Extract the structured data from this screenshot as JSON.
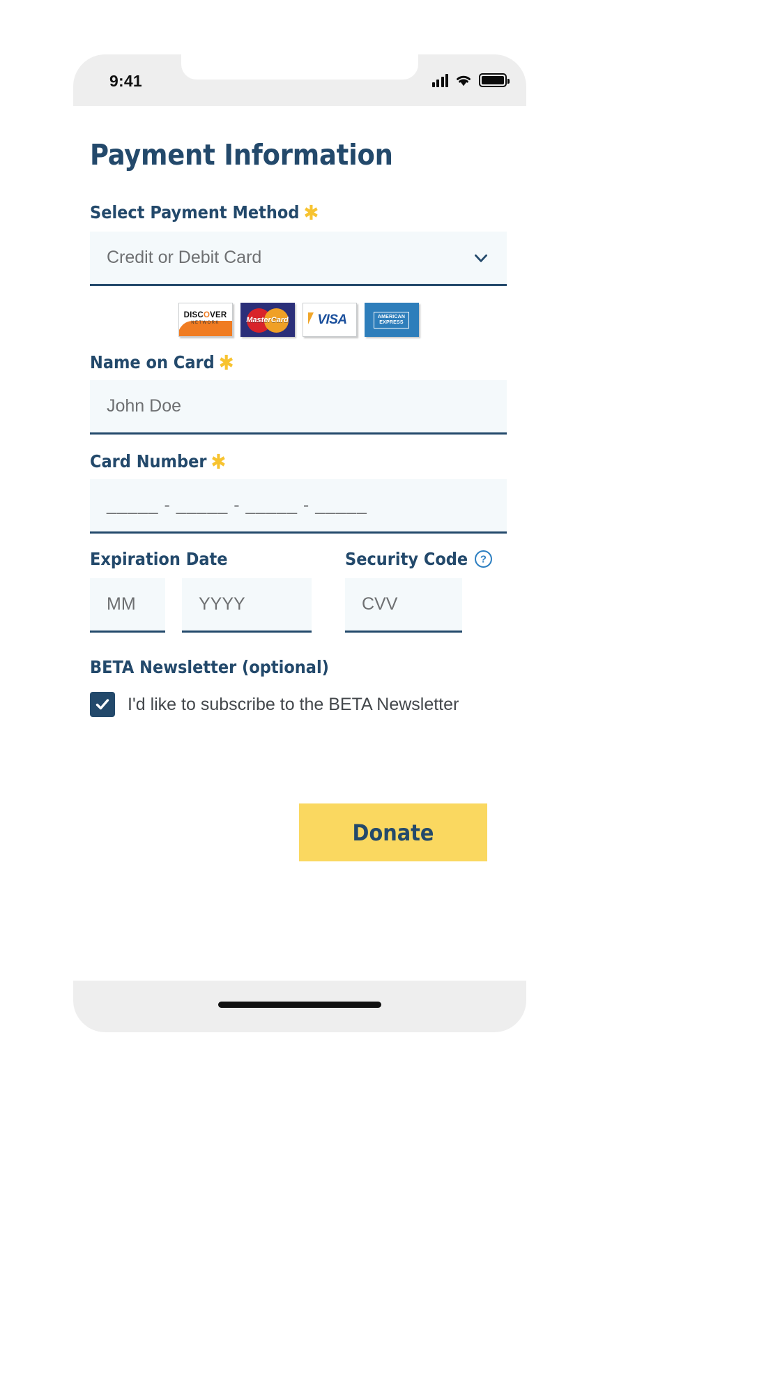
{
  "status_bar": {
    "time": "9:41",
    "signal_icon": "cellular-signal-icon",
    "wifi_icon": "wifi-icon",
    "battery_icon": "battery-full-icon"
  },
  "page": {
    "title": "Payment Information"
  },
  "payment_method": {
    "label": "Select Payment Method",
    "required_marker": "✱",
    "selected_value": "Credit or Debit Card",
    "options": [
      "Credit or Debit Card"
    ],
    "chevron_icon": "chevron-down-icon"
  },
  "accepted_cards": [
    {
      "name": "discover",
      "text": "DISCOVER",
      "subtext": "NETWORK"
    },
    {
      "name": "mastercard",
      "text": "MasterCard"
    },
    {
      "name": "visa",
      "text": "VISA"
    },
    {
      "name": "amex",
      "line1": "AMERICAN",
      "line2": "EXPRESS"
    }
  ],
  "name_on_card": {
    "label": "Name on Card",
    "required_marker": "✱",
    "placeholder": "John Doe",
    "value": ""
  },
  "card_number": {
    "label": "Card Number",
    "required_marker": "✱",
    "placeholder": "_____ - _____ - _____ - _____",
    "value": ""
  },
  "expiration": {
    "label": "Expiration Date",
    "month_placeholder": "MM",
    "month_value": "",
    "year_placeholder": "YYYY",
    "year_value": ""
  },
  "security_code": {
    "label": "Security Code",
    "help_icon": "question-mark-circle-icon",
    "placeholder": "CVV",
    "value": ""
  },
  "newsletter": {
    "label": "BETA Newsletter (optional)",
    "checkbox_checked": true,
    "checkbox_icon": "checkmark-icon",
    "text": "I'd like to subscribe to the BETA Newsletter"
  },
  "submit": {
    "label": "Donate"
  },
  "home_indicator": "home-bar",
  "colors": {
    "navy": "#23496b",
    "gold": "#f7c330",
    "button": "#fad860",
    "field_bg": "#f4f9fb",
    "placeholder": "#6e7072"
  }
}
